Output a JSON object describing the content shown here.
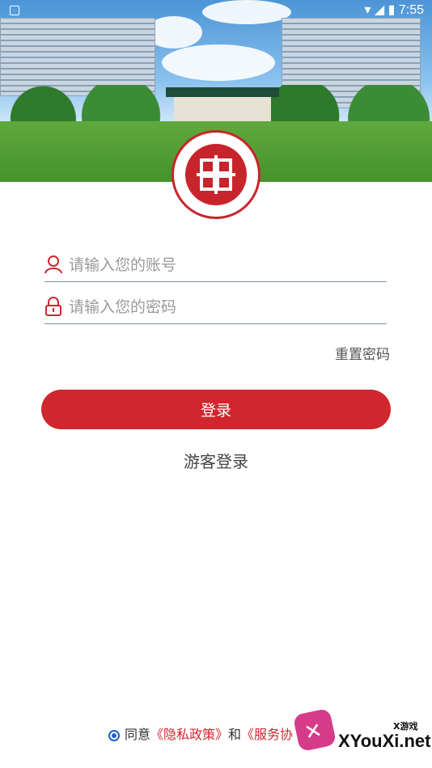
{
  "status_bar": {
    "time": "7:55"
  },
  "login": {
    "account_placeholder": "请输入您的账号",
    "password_placeholder": "请输入您的密码",
    "reset_password": "重置密码",
    "login_button": "登录",
    "guest_login": "游客登录"
  },
  "agreement": {
    "prefix": "同意",
    "privacy_policy": "《隐私政策》",
    "and": "和",
    "service_agreement": "《服务协"
  },
  "watermark": {
    "small": "X游戏",
    "main": "XYouXi.net"
  },
  "colors": {
    "primary": "#d0262e",
    "radio": "#1f63c4",
    "underline": "#7f8fa6"
  },
  "icons": {
    "account": "user-icon",
    "password": "lock-icon",
    "agree": "radio-checked-icon"
  }
}
